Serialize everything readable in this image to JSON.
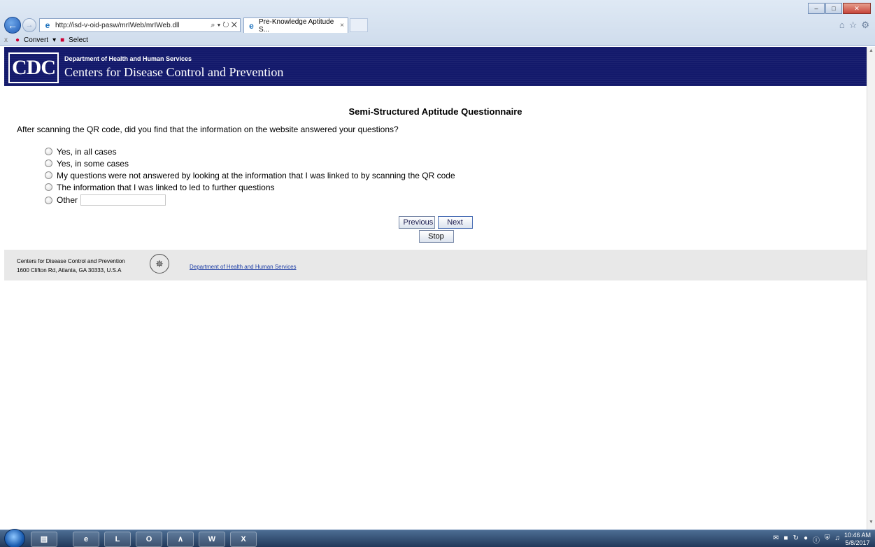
{
  "browser": {
    "url": "http://isd-v-oid-pasw/mrIWeb/mrIWeb.dll",
    "address_actions": "⌕ ▾ ↻ ✕",
    "tab_title": "Pre-Knowledge Aptitude S...",
    "tab_close": "×",
    "command_bar": {
      "close": "x",
      "convert_label": "Convert",
      "select_label": "Select"
    },
    "window_controls": {
      "minimize": "–",
      "maximize": "□",
      "close": "✕"
    }
  },
  "header": {
    "logo_text": "CDC",
    "department": "Department of Health and Human Services",
    "center": "Centers for Disease Control and Prevention"
  },
  "survey": {
    "title": "Semi-Structured Aptitude Questionnaire",
    "question": "After scanning the QR code, did you find that the information on the website answered your questions?",
    "options": [
      "Yes, in all cases",
      "Yes, in some cases",
      "My questions were not answered by looking at the information that I was linked to by scanning the QR code",
      "The information that I was linked to led to further questions",
      "Other"
    ],
    "other_value": "",
    "buttons": {
      "previous": "Previous",
      "next": "Next",
      "stop": "Stop"
    }
  },
  "footer": {
    "org": "Centers for Disease Control and Prevention",
    "address": "1600 Clifton Rd, Atlanta, GA 30333, U.S.A",
    "link": "Department of Health and Human Services"
  },
  "taskbar": {
    "apps": [
      "explorer",
      "internet-explorer",
      "task-manager",
      "outlook",
      "acrobat",
      "word",
      "excel"
    ],
    "app_glyphs": [
      "▤",
      "e",
      "L",
      "O",
      "∧",
      "W",
      "X"
    ],
    "clock_time": "10:46 AM",
    "clock_date": "5/8/2017"
  },
  "colors": {
    "header_bg": "#13196b",
    "footer_bg": "#e8e8e8",
    "link": "#1f3fa6"
  }
}
